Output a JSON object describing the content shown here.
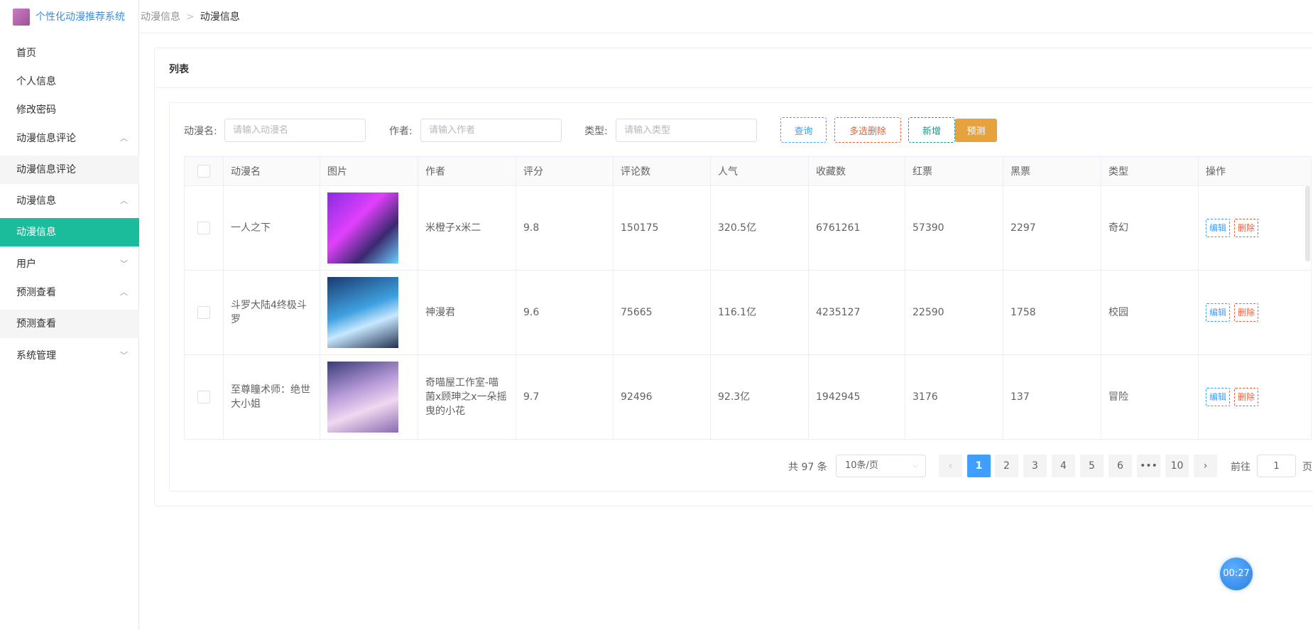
{
  "app": {
    "title": "个性化动漫推荐系统"
  },
  "breadcrumb": [
    "动漫信息",
    "动漫信息"
  ],
  "breadcrumb_sep": ">",
  "sidebar": {
    "items": [
      {
        "label": "首页"
      },
      {
        "label": "个人信息"
      },
      {
        "label": "修改密码"
      },
      {
        "label": "动漫信息评论",
        "chevron": "up"
      },
      {
        "label": "动漫信息评论",
        "sub": true
      },
      {
        "label": "动漫信息",
        "chevron": "up"
      },
      {
        "label": "动漫信息",
        "sub": true,
        "active": true
      },
      {
        "label": "用户",
        "chevron": "down"
      },
      {
        "label": "预测查看",
        "chevron": "up"
      },
      {
        "label": "预测查看",
        "sub": true
      },
      {
        "label": "系统管理",
        "chevron": "down"
      }
    ]
  },
  "card": {
    "title": "列表"
  },
  "search": {
    "name_label": "动漫名:",
    "name_placeholder": "请输入动漫名",
    "author_label": "作者:",
    "author_placeholder": "请输入作者",
    "type_label": "类型:",
    "type_placeholder": "请输入类型",
    "query": "查询",
    "batch_delete": "多选删除",
    "add": "新增",
    "predict": "预测"
  },
  "table": {
    "headers": [
      "动漫名",
      "图片",
      "作者",
      "评分",
      "评论数",
      "人气",
      "收藏数",
      "红票",
      "黑票",
      "类型",
      "操作"
    ],
    "edit_label": "编辑",
    "delete_label": "删除",
    "rows": [
      [
        "一人之下",
        "",
        "米橙子x米二",
        "9.8",
        "150175",
        "320.5亿",
        "6761261",
        "57390",
        "2297",
        "奇幻"
      ],
      [
        "斗罗大陆4终极斗罗",
        "",
        "神漫君",
        "9.6",
        "75665",
        "116.1亿",
        "4235127",
        "22590",
        "1758",
        "校园"
      ],
      [
        "至尊瞳术师：绝世大小姐",
        "",
        "奇喵屋工作室-喵菌x顾珅之x一朵摇曳的小花",
        "9.7",
        "92496",
        "92.3亿",
        "1942945",
        "3176",
        "137",
        "冒险"
      ]
    ]
  },
  "pagination": {
    "total": "共 97 条",
    "page_size": "10条/页",
    "pages": [
      "1",
      "2",
      "3",
      "4",
      "5",
      "6",
      "•••",
      "10"
    ],
    "current": "1",
    "goto_label": "前往",
    "goto_value": "1",
    "page_suffix": "页"
  },
  "timer": "00:27",
  "colors": {
    "accent": "#1abc9c",
    "primary": "#409eff",
    "danger": "#e6633e",
    "success": "#1a9a86",
    "warning": "#e6a23c"
  }
}
